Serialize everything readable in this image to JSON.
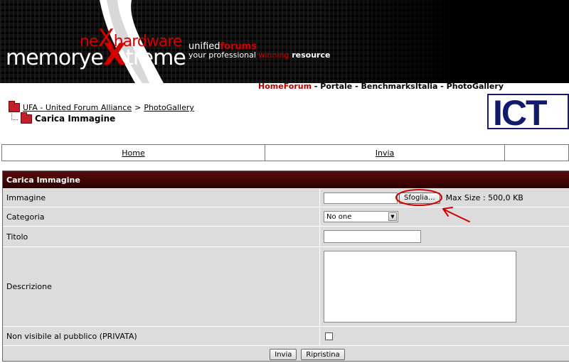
{
  "header": {
    "brand_part1": "memory",
    "brand_part2": "e",
    "brand_part3": "X",
    "brand_part4": "treme",
    "next_part1": "ne",
    "next_part2": "X",
    "next_part3": "hardware",
    "tag_unified": "unified",
    "tag_forums": "forums",
    "tag_line_1": "your professional ",
    "tag_line_winning": "winning",
    "tag_line_resource": " resource"
  },
  "topnav": {
    "home_forum": "HomeForum",
    "sep": " - ",
    "portale": "Portale",
    "benchmarks": "BenchmarksItalia",
    "photogallery": "PhotoGallery"
  },
  "breadcrumb": {
    "root": "UFA - United Forum Alliance",
    "separator": ">",
    "parent": "PhotoGallery",
    "current": "Carica Immagine"
  },
  "ict_logo": "ICT",
  "menu": {
    "home": "Home",
    "invia": "Invia"
  },
  "form": {
    "title": "Carica Immagine",
    "immagine_label": "Immagine",
    "browse_button": "Sfoglia...",
    "max_size": "Max Size : 500,0 KB",
    "categoria_label": "Categoria",
    "categoria_selected": "No one",
    "titolo_label": "Titolo",
    "descrizione_label": "Descrizione",
    "privata_label": "Non visibile al pubblico (PRIVATA)",
    "submit_button": "Invia",
    "reset_button": "Ripristina"
  },
  "colors": {
    "accent_red": "#d40000",
    "header_dark_red": "#3a0000",
    "ict_blue": "#111a6b",
    "annotation_red": "#d00000"
  }
}
